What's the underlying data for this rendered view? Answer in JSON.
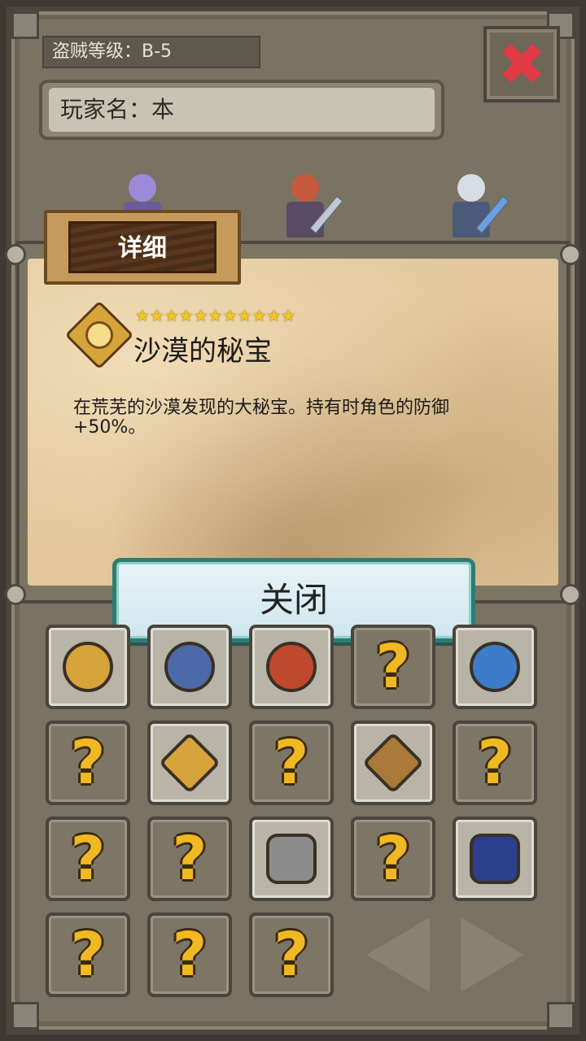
{
  "header": {
    "rank_label": "盗贼等级：B-5",
    "player_label": "玩家名：本"
  },
  "tab": {
    "detail_label": "详细"
  },
  "item": {
    "stars": "★★★★★★★★★★★",
    "star_count": 11,
    "name": "沙漠的秘宝",
    "description": "在荒芜的沙漠发现的大秘宝。持有时角色的防御+50%。",
    "icon": "lion-crest-icon"
  },
  "close_button": {
    "label": "关闭"
  },
  "colors": {
    "accent_teal": "#2e7d74",
    "close_red": "#e03a44",
    "parchment": "#e2c89c",
    "star_gold": "#f4c81e"
  },
  "collection": {
    "cells": [
      {
        "state": "unlocked",
        "icon": "gold-sun-badge-icon",
        "color": "#d7a43c"
      },
      {
        "state": "unlocked",
        "icon": "horned-blue-skull-icon",
        "color": "#4d6aa8"
      },
      {
        "state": "unlocked",
        "icon": "crossed-swords-shield-icon",
        "color": "#c0482c"
      },
      {
        "state": "locked",
        "icon": "question-mark-icon",
        "q": "?"
      },
      {
        "state": "unlocked",
        "icon": "blue-helmet-crest-icon",
        "color": "#3c7cc8"
      },
      {
        "state": "locked",
        "icon": "question-mark-icon",
        "q": "?"
      },
      {
        "state": "unlocked",
        "icon": "lion-crest-icon",
        "color": "#d7a43c"
      },
      {
        "state": "locked",
        "icon": "question-mark-icon",
        "q": "?"
      },
      {
        "state": "unlocked",
        "icon": "crossed-blades-scroll-icon",
        "color": "#a97a3a"
      },
      {
        "state": "locked",
        "icon": "question-mark-icon",
        "q": "?"
      },
      {
        "state": "locked",
        "icon": "question-mark-icon",
        "q": "?"
      },
      {
        "state": "locked",
        "icon": "question-mark-icon",
        "q": "?"
      },
      {
        "state": "unlocked",
        "icon": "silver-ingot-icon",
        "color": "#8c8c8c"
      },
      {
        "state": "locked",
        "icon": "question-mark-icon",
        "q": "?"
      },
      {
        "state": "unlocked",
        "icon": "dark-ore-octagon-icon",
        "color": "#2d3e8c"
      },
      {
        "state": "locked",
        "icon": "question-mark-icon",
        "q": "?"
      },
      {
        "state": "locked",
        "icon": "question-mark-icon",
        "q": "?"
      },
      {
        "state": "locked",
        "icon": "question-mark-icon",
        "q": "?"
      }
    ]
  }
}
